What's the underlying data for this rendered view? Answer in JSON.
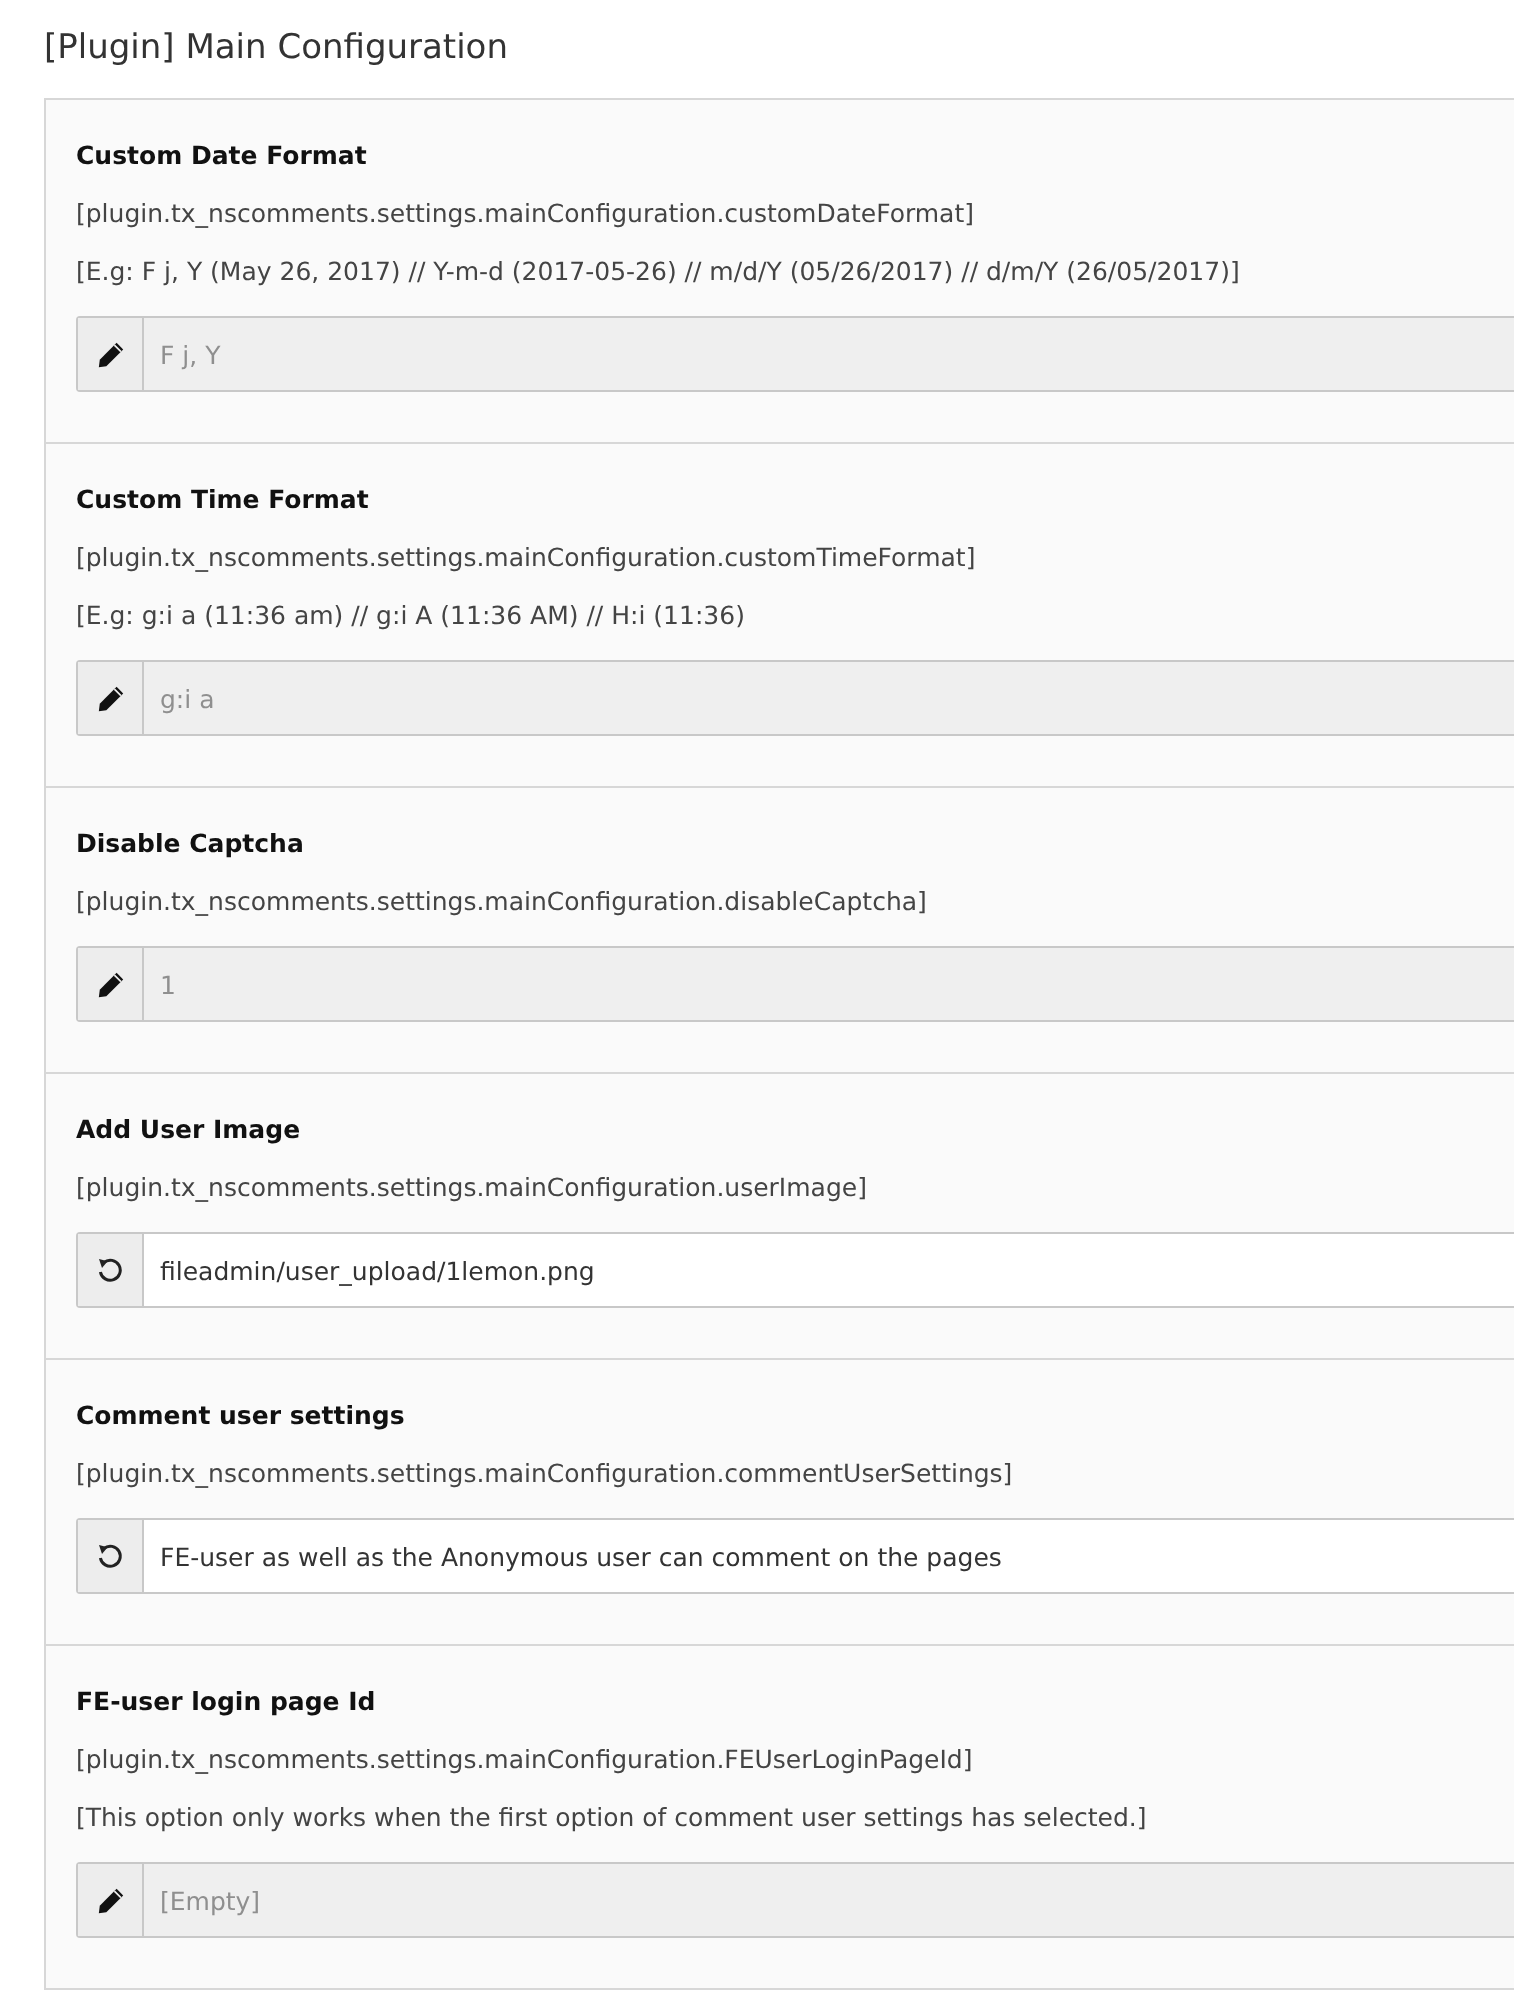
{
  "heading": "[Plugin] Main Configuration",
  "settings": [
    {
      "label": "Custom Date Format",
      "hints": [
        "[plugin.tx_nscomments.settings.mainConfiguration.customDateFormat]",
        "[E.g: F j, Y (May 26, 2017) // Y-m-d (2017-05-26) // m/d/Y (05/26/2017) // d/m/Y (26/05/2017)]"
      ],
      "field": {
        "kind": "default",
        "placeholder": "F j, Y"
      }
    },
    {
      "label": "Custom Time Format",
      "hints": [
        "[plugin.tx_nscomments.settings.mainConfiguration.customTimeFormat]",
        "[E.g: g:i a (11:36 am) // g:i A (11:36 AM) // H:i (11:36)"
      ],
      "field": {
        "kind": "default",
        "placeholder": "g:i a"
      }
    },
    {
      "label": "Disable Captcha",
      "hints": [
        "[plugin.tx_nscomments.settings.mainConfiguration.disableCaptcha]"
      ],
      "field": {
        "kind": "default",
        "placeholder": "1"
      }
    },
    {
      "label": "Add User Image",
      "hints": [
        "[plugin.tx_nscomments.settings.mainConfiguration.userImage]"
      ],
      "field": {
        "kind": "custom",
        "value": "fileadmin/user_upload/1lemon.png"
      }
    },
    {
      "label": "Comment user settings",
      "hints": [
        "[plugin.tx_nscomments.settings.mainConfiguration.commentUserSettings]"
      ],
      "field": {
        "kind": "custom",
        "value": "FE-user as well as the Anonymous user can comment on the pages"
      }
    },
    {
      "label": "FE-user login page Id",
      "hints": [
        "[plugin.tx_nscomments.settings.mainConfiguration.FEUserLoginPageId]",
        "[This option only works when the first option of comment user settings has selected.]"
      ],
      "field": {
        "kind": "default",
        "placeholder": "[Empty]"
      }
    }
  ]
}
